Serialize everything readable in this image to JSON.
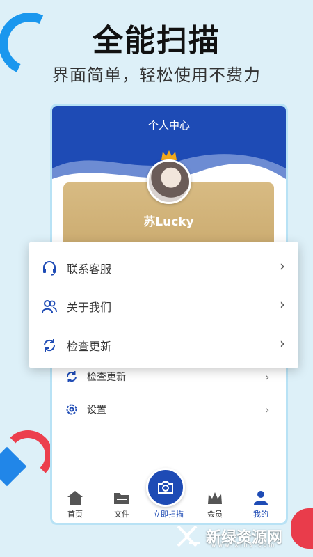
{
  "hero": {
    "title": "全能扫描",
    "subtitle": "界面简单，轻松使用不费力"
  },
  "phone": {
    "header_title": "个人中心",
    "username": "苏Lucky",
    "menu": [
      {
        "label": "检查更新",
        "icon": "refresh-icon"
      },
      {
        "label": "设置",
        "icon": "gear-icon"
      }
    ],
    "tabs": [
      {
        "label": "首页",
        "icon": "home-icon"
      },
      {
        "label": "文件",
        "icon": "folder-icon"
      },
      {
        "label": "立即扫描",
        "icon": "camera-icon"
      },
      {
        "label": "会员",
        "icon": "crown-icon"
      },
      {
        "label": "我的",
        "icon": "user-icon"
      }
    ]
  },
  "popup": {
    "items": [
      {
        "label": "联系客服",
        "icon": "headset-icon"
      },
      {
        "label": "关于我们",
        "icon": "users-icon"
      },
      {
        "label": "检查更新",
        "icon": "refresh-icon"
      }
    ]
  },
  "watermark": {
    "text": "新绿资源网",
    "url": "www.xlhs.com"
  },
  "colors": {
    "brand_blue": "#1e4bb5",
    "background": "#ddf0f8",
    "accent_red": "#ec3f4d",
    "card_gold": "#d8bb83"
  }
}
